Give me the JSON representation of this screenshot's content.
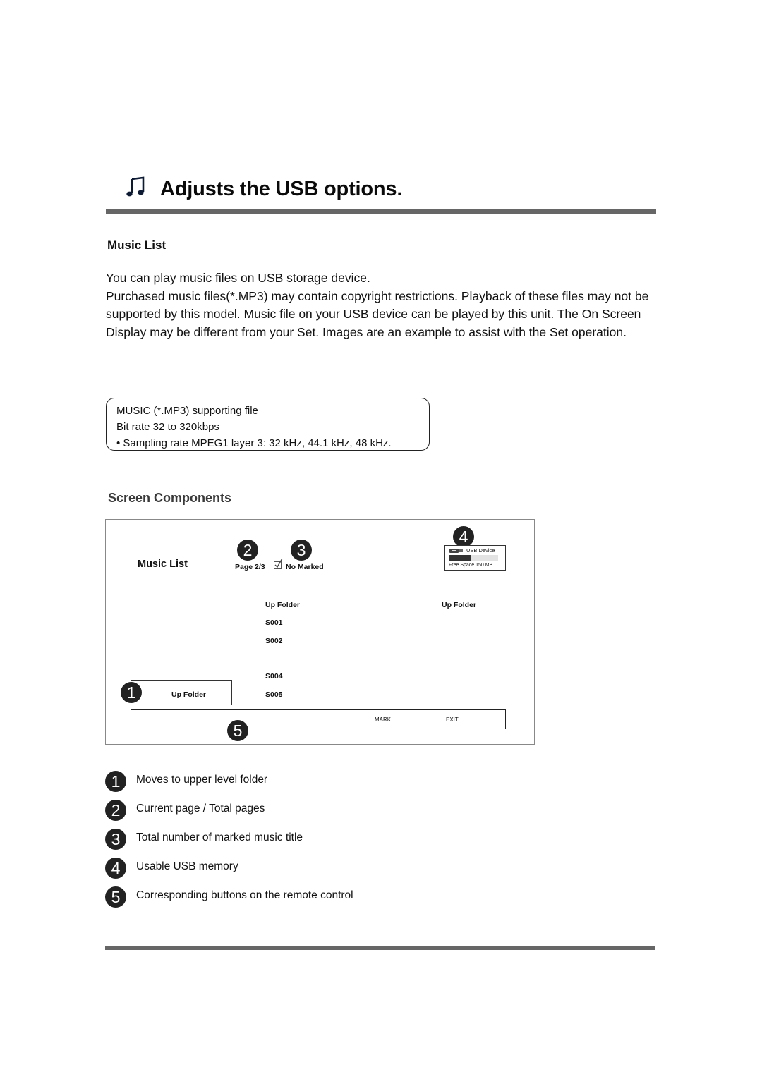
{
  "header": {
    "icon": "music-note-icon",
    "title": "Adjusts the USB options."
  },
  "section": {
    "title": "Music List",
    "paragraphs": [
      "You can play music files on USB storage device.",
      "Purchased music files(*.MP3) may contain copyright restrictions. Playback of these files may not be supported by this model. Music file on your USB device can be played by this unit. The On Screen Display may be different from your Set. Images are an example to assist with the Set operation."
    ]
  },
  "info_box": {
    "lines": [
      "MUSIC (*.MP3) supporting file",
      "Bit rate 32 to 320kbps",
      "• Sampling rate MPEG1 layer 3: 32 kHz, 44.1 kHz, 48 kHz."
    ]
  },
  "components": {
    "title": "Screen Components"
  },
  "osd": {
    "title": "Music List",
    "page_indicator": "Page 2/3",
    "page_current": 2,
    "page_total": 3,
    "marked_status": "No Marked",
    "usb": {
      "icon": "usb-plug-icon",
      "label": "USB Device",
      "free_space": "Free Space 150 MB",
      "usage_fraction": 0.45
    },
    "list_items": [
      "Up Folder",
      "S001",
      "S002",
      "",
      "S004",
      "S005"
    ],
    "preview_label": "Up Folder",
    "selected_item": "Up Folder",
    "buttons": {
      "mark": "MARK",
      "exit": "EXIT"
    },
    "badges": [
      "1",
      "2",
      "3",
      "4",
      "5"
    ]
  },
  "legend": [
    {
      "number": "1",
      "text": "Moves to upper level folder"
    },
    {
      "number": "2",
      "text": "Current page / Total pages"
    },
    {
      "number": "3",
      "text": "Total number of marked music title"
    },
    {
      "number": "4",
      "text": "Usable USB memory"
    },
    {
      "number": "5",
      "text": "Corresponding buttons on the remote control"
    }
  ]
}
